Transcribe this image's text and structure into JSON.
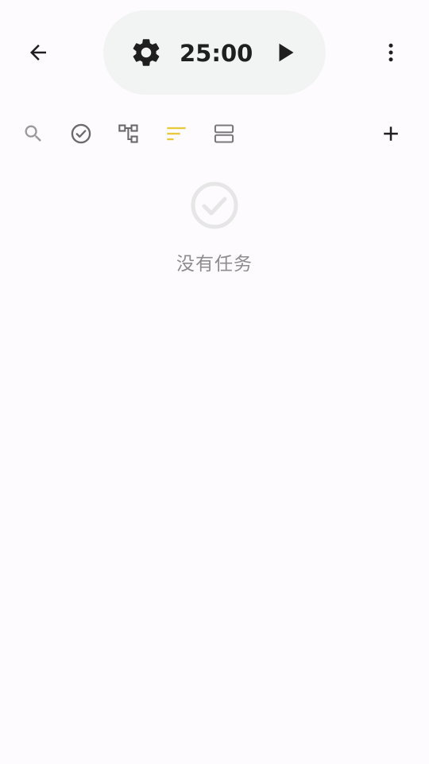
{
  "header": {
    "back_icon": "arrow-left-icon",
    "more_icon": "more-vertical-icon",
    "timer": {
      "time": "25:00",
      "settings_icon": "gear-icon",
      "play_icon": "play-icon"
    }
  },
  "toolbar": {
    "items": [
      {
        "icon": "search-icon",
        "color": "#9a9a9a"
      },
      {
        "icon": "check-circle-icon",
        "color": "#6a6a6a"
      },
      {
        "icon": "hierarchy-icon",
        "color": "#6a6a6a"
      },
      {
        "icon": "sort-lines-icon",
        "color": "#e8c93a"
      },
      {
        "icon": "layout-rows-icon",
        "color": "#7a7a7a"
      }
    ],
    "add_icon": "plus-icon"
  },
  "empty_state": {
    "icon": "check-circle-icon",
    "message": "没有任务"
  },
  "colors": {
    "background": "#fdfbfe",
    "pill": "#f2f3f3",
    "accent": "#e8c93a",
    "text_dark": "#1f1f1f",
    "text_muted": "#8d8d8d"
  }
}
